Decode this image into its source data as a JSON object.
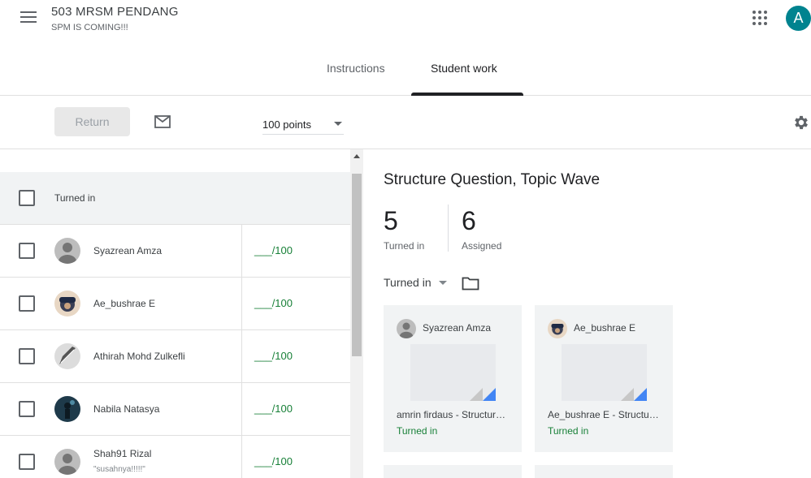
{
  "header": {
    "class_title": "503 MRSM PENDANG",
    "class_subtitle": "SPM IS COMING!!!",
    "avatar_letter": "A",
    "avatar_color": "#00838f"
  },
  "tabs": [
    {
      "label": "Instructions",
      "active": false
    },
    {
      "label": "Student work",
      "active": true
    }
  ],
  "toolbar": {
    "return_label": "Return",
    "points_label": "100 points"
  },
  "list": {
    "section_label": "Turned in",
    "students": [
      {
        "name": "Syazrean Amza",
        "comment": "",
        "grade": "___/100",
        "avatar": "default"
      },
      {
        "name": "Ae_bushrae E",
        "comment": "",
        "grade": "___/100",
        "avatar": "photo-cap"
      },
      {
        "name": "Athirah Mohd Zulkefli",
        "comment": "",
        "grade": "___/100",
        "avatar": "photo-feather"
      },
      {
        "name": "Nabila Natasya",
        "comment": "",
        "grade": "___/100",
        "avatar": "photo-figure"
      },
      {
        "name": "Shah91 Rizal",
        "comment": "\"susahnya!!!!!\"",
        "grade": "___/100",
        "avatar": "default"
      }
    ]
  },
  "assignment": {
    "title": "Structure Question, Topic Wave",
    "turned_in_count": "5",
    "turned_in_label": "Turned in",
    "assigned_count": "6",
    "assigned_label": "Assigned",
    "filter_label": "Turned in"
  },
  "cards": [
    {
      "name": "Syazrean Amza",
      "file": "amrin firdaus - Structure Question",
      "status": "Turned in",
      "avatar": "default"
    },
    {
      "name": "Ae_bushrae E",
      "file": "Ae_bushrae E - Structure Question",
      "status": "Turned in",
      "avatar": "photo-cap"
    }
  ],
  "colors": {
    "accent_green": "#188038",
    "tab_indicator": "#202124",
    "doc_blue": "#4285f4"
  }
}
